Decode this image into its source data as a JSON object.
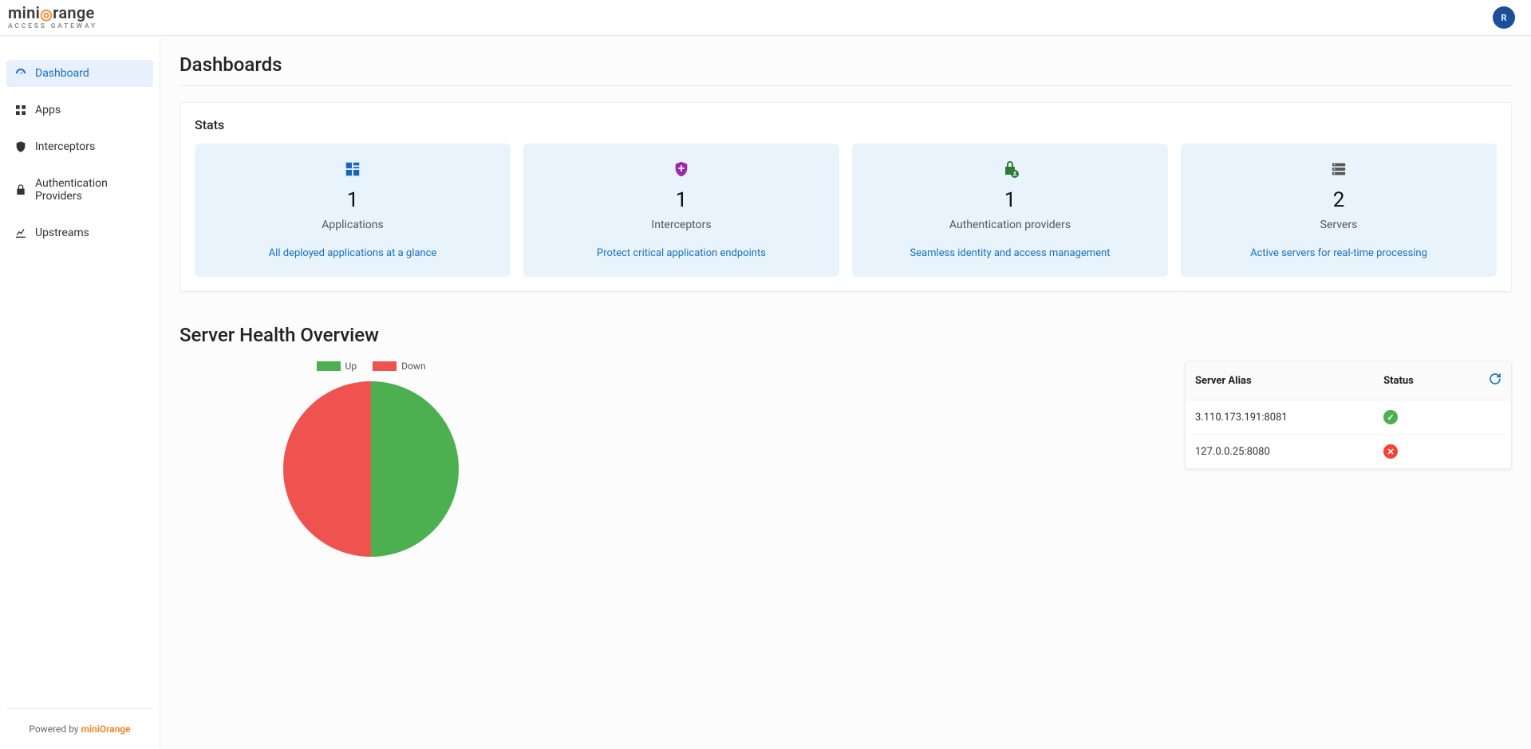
{
  "brand": {
    "name_prefix": "mini",
    "name_suffix": "range",
    "subtitle": "ACCESS GATEWAY"
  },
  "header": {
    "avatar_initial": "R"
  },
  "sidebar": {
    "items": [
      {
        "label": "Dashboard"
      },
      {
        "label": "Apps"
      },
      {
        "label": "Interceptors"
      },
      {
        "label": "Authentication Providers"
      },
      {
        "label": "Upstreams"
      }
    ],
    "footer_prefix": "Powered by ",
    "footer_brand": "miniOrange"
  },
  "page": {
    "title": "Dashboards"
  },
  "stats": {
    "title": "Stats",
    "cards": [
      {
        "value": "1",
        "label": "Applications",
        "desc": "All deployed applications at a glance"
      },
      {
        "value": "1",
        "label": "Interceptors",
        "desc": "Protect critical application endpoints"
      },
      {
        "value": "1",
        "label": "Authentication providers",
        "desc": "Seamless identity and access management"
      },
      {
        "value": "2",
        "label": "Servers",
        "desc": "Active servers for real-time processing"
      }
    ]
  },
  "health": {
    "title": "Server Health Overview",
    "legend": {
      "up": "Up",
      "down": "Down"
    },
    "table": {
      "col_alias": "Server Alias",
      "col_status": "Status",
      "rows": [
        {
          "alias": "3.110.173.191:8081",
          "status": "up"
        },
        {
          "alias": "127.0.0.25:8080",
          "status": "down"
        }
      ]
    }
  },
  "chart_data": {
    "type": "pie",
    "title": "Server Health Overview",
    "series": [
      {
        "name": "Up",
        "value": 1,
        "color": "#4caf50"
      },
      {
        "name": "Down",
        "value": 1,
        "color": "#ef5350"
      }
    ]
  }
}
